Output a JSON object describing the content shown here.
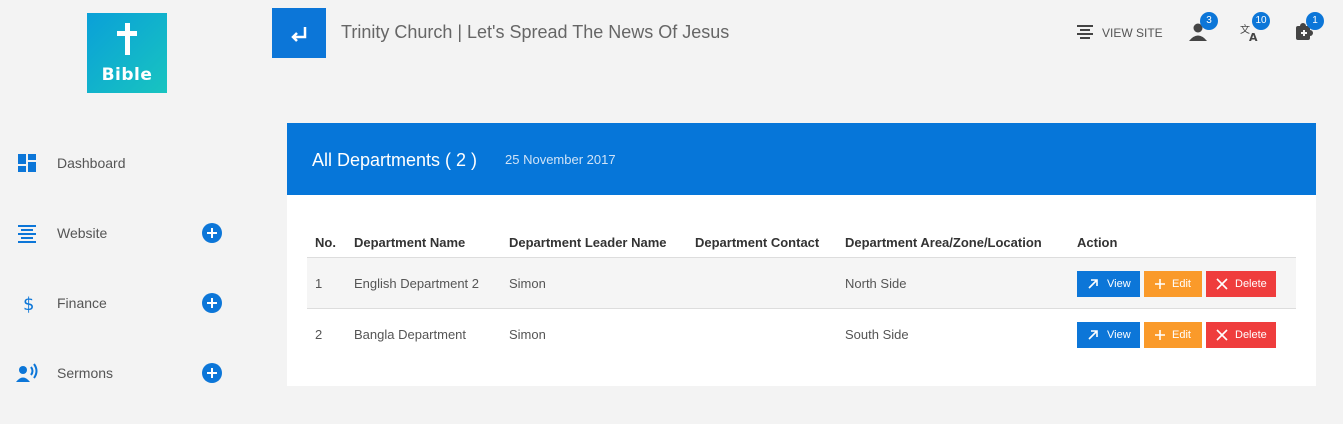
{
  "logo": {
    "text": "Bible"
  },
  "sidebar": {
    "items": [
      {
        "label": "Dashboard",
        "icon": "dashboard-icon",
        "expandable": false
      },
      {
        "label": "Website",
        "icon": "website-icon",
        "expandable": true
      },
      {
        "label": "Finance",
        "icon": "dollar-icon",
        "expandable": true
      },
      {
        "label": "Sermons",
        "icon": "speaker-icon",
        "expandable": true
      }
    ]
  },
  "header": {
    "title": "Trinity Church | Let's Spread The News Of Jesus",
    "view_site": "VIEW SITE",
    "user_badge": "3",
    "translate_badge": "10",
    "puzzle_badge": "1"
  },
  "panel": {
    "title": "All Departments ( 2 )",
    "date": "25 November 2017"
  },
  "table": {
    "headers": {
      "no": "No.",
      "name": "Department Name",
      "leader": "Department Leader Name",
      "contact": "Department Contact",
      "area": "Department Area/Zone/Location",
      "action": "Action"
    },
    "rows": [
      {
        "no": "1",
        "name": "English Department 2",
        "leader": "Simon",
        "contact": "",
        "area": "North Side"
      },
      {
        "no": "2",
        "name": "Bangla Department",
        "leader": "Simon",
        "contact": "",
        "area": "South Side"
      }
    ],
    "actions": {
      "view": "View",
      "edit": "Edit",
      "delete": "Delete"
    }
  },
  "colors": {
    "accent": "#0676d9",
    "edit": "#fa9a2a",
    "delete": "#ef3d3d",
    "logo_gradient_start": "#0aa0d8",
    "logo_gradient_end": "#18c4c0"
  }
}
